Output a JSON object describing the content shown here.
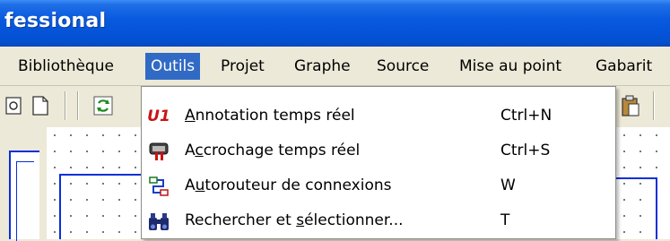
{
  "window": {
    "title": "fessional"
  },
  "menubar": {
    "items": [
      {
        "label": "Bibliothèque"
      },
      {
        "label": "Outils"
      },
      {
        "label": "Projet"
      },
      {
        "label": "Graphe"
      },
      {
        "label": "Source"
      },
      {
        "label": "Mise au point"
      },
      {
        "label": "Gabarit"
      }
    ],
    "active": "Outils"
  },
  "toolbar": {
    "icons": [
      "save-icon",
      "new-document-icon",
      "refresh-icon",
      "paste-icon"
    ]
  },
  "dropdown": {
    "items": [
      {
        "icon": "realtime-annotation-icon",
        "icon_text": "U1",
        "label_pre": "",
        "label_ul": "A",
        "label_post": "nnotation temps réel",
        "shortcut": "Ctrl+N"
      },
      {
        "icon": "magnet-hook-icon",
        "label_pre": "A",
        "label_ul": "c",
        "label_post": "crochage temps réel",
        "shortcut": "Ctrl+S"
      },
      {
        "icon": "autorouter-icon",
        "label_pre": "A",
        "label_ul": "u",
        "label_post": "torouteur de connexions",
        "shortcut": "W"
      },
      {
        "icon": "binoculars-icon",
        "label_pre": "Rechercher et ",
        "label_ul": "s",
        "label_post": "électionner...",
        "shortcut": "T"
      }
    ]
  },
  "colors": {
    "titlebar": "#0453d8",
    "menu_highlight": "#316ac5",
    "pane_border": "#0b2fd8",
    "face": "#ece9d8"
  }
}
